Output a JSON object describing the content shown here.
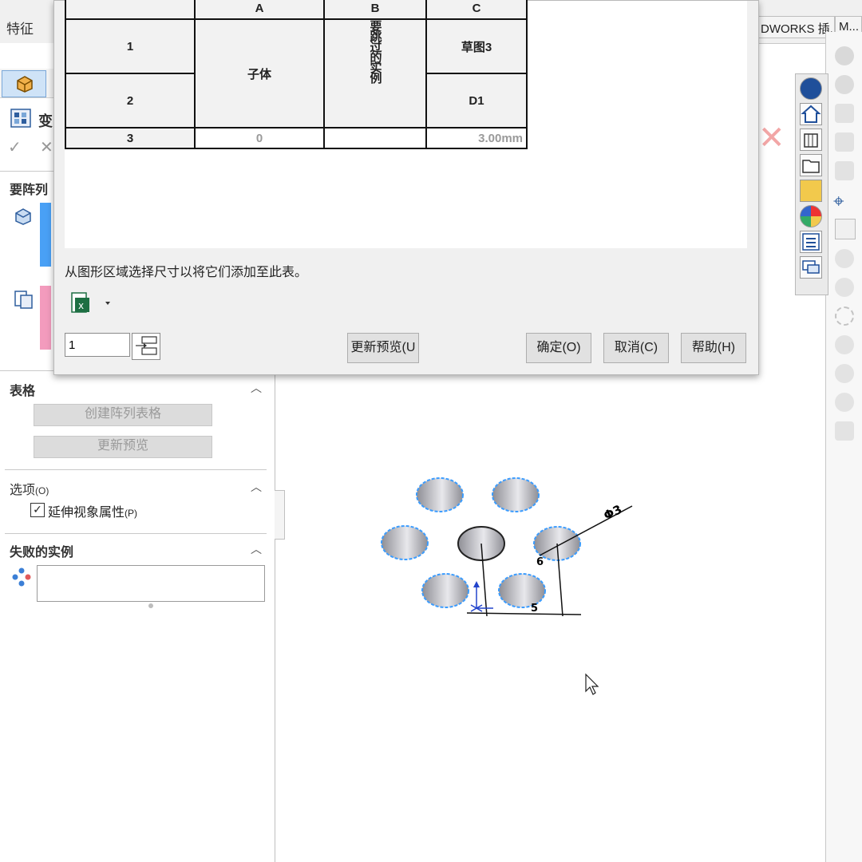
{
  "top_bar": {
    "features_tab": "特征",
    "right_tabs": [
      "DWORKS 插...",
      "M..."
    ]
  },
  "left_panel": {
    "feature_title": "变",
    "section_pattern": "要阵列",
    "section_table": "表格",
    "create_table_button": "创建阵列表格",
    "update_preview_button": "更新预览",
    "section_options": "选项",
    "options_shortcut": "(O)",
    "propagate_label": "延伸视象属性",
    "propagate_shortcut": "(P)",
    "propagate_checked": true,
    "section_failed": "失败的实例"
  },
  "dialog": {
    "table": {
      "col_headers": [
        "A",
        "B",
        "C"
      ],
      "row_headers": [
        "1",
        "2",
        "3"
      ],
      "a_header": "子体",
      "b_header": "要跳过的实例",
      "c1_header": "草图3",
      "c2_header": "D1",
      "row3_a": "0",
      "row3_c": "3.00mm"
    },
    "hint": "从图形区域选择尺寸以将它们添加至此表。",
    "instance_input": "1",
    "update_preview_button": "更新预览(U",
    "ok_button": "确定(O)",
    "cancel_button": "取消(C)",
    "help_button": "帮助(H)"
  },
  "graphics": {
    "dimension_diameter": "Φ3",
    "dimension_6": "6",
    "dimension_5": "5"
  },
  "colors": {
    "selection_blue": "#3b9cff",
    "reject_red": "#f2a6a6"
  }
}
